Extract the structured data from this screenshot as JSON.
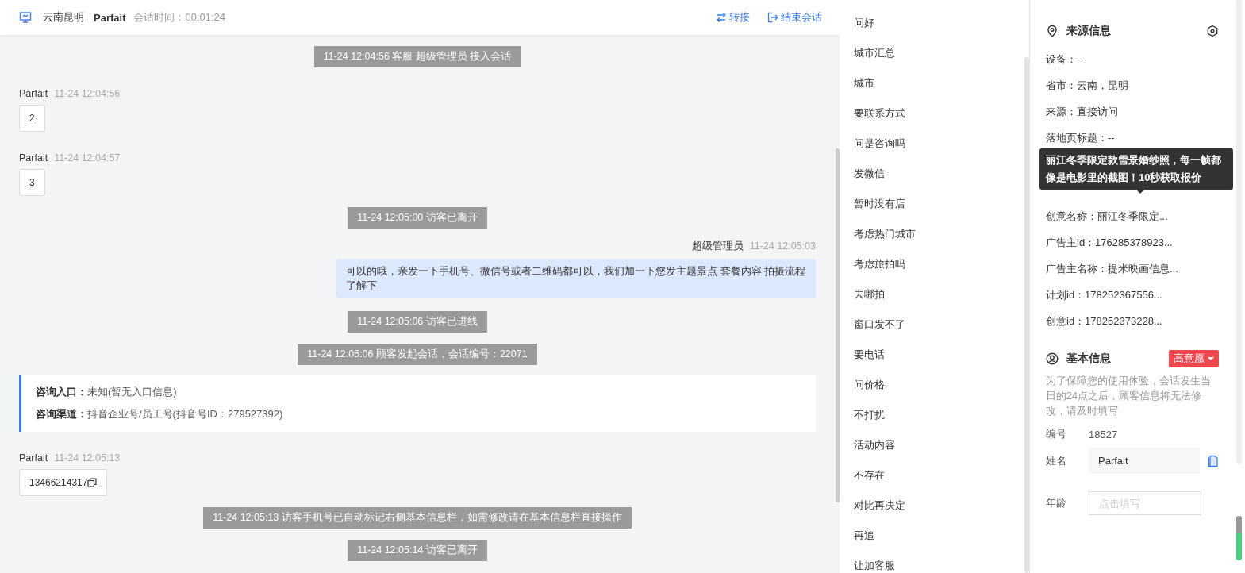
{
  "header": {
    "location": "云南昆明",
    "visitor": "Parfait",
    "timer_label": "会话时间：",
    "timer": "00:01:24",
    "actions": [
      {
        "label": "转接",
        "kind": "transfer"
      },
      {
        "label": "结束会话",
        "kind": "end"
      }
    ]
  },
  "messages": [
    {
      "kind": "system",
      "text": "11-24 12:04:56 客服 超级管理员 接入会话"
    },
    {
      "kind": "visitor",
      "name": "Parfait",
      "time": "11-24 12:04:56",
      "text": "2"
    },
    {
      "kind": "visitor",
      "name": "Parfait",
      "time": "11-24 12:04:57",
      "text": "3"
    },
    {
      "kind": "system",
      "text": "11-24 12:05:00 访客已离开"
    },
    {
      "kind": "agent",
      "name": "超级管理员",
      "time": "11-24 12:05:03",
      "text": "可以的哦，亲发一下手机号、微信号或者二维码都可以，我们加一下您发主题景点 套餐内容 拍摄流程了解下"
    },
    {
      "kind": "system",
      "text": "11-24 12:05:06 访客已进线"
    },
    {
      "kind": "system",
      "text": "11-24 12:05:06 顾客发起会话，会话编号：22071"
    },
    {
      "kind": "info",
      "lines": [
        {
          "label": "咨询入口：",
          "value": "未知(暂无入口信息)"
        },
        {
          "label": "咨询渠道：",
          "value": "抖音企业号/员工号(抖音号ID：279527392)"
        }
      ]
    },
    {
      "kind": "visitor",
      "name": "Parfait",
      "time": "11-24 12:05:13",
      "text": "13466214317",
      "copy": true
    },
    {
      "kind": "system",
      "text": "11-24 12:05:13 访客手机号已自动标记右侧基本信息栏，如需修改请在基本信息栏直接操作"
    },
    {
      "kind": "system",
      "text": "11-24 12:05:14 访客已离开"
    }
  ],
  "quick_replies": [
    "问好",
    "城市汇总",
    "城市",
    "要联系方式",
    "问是咨询吗",
    "发微信",
    "暂时没有店",
    "考虑热门城市",
    "考虑旅拍吗",
    "去哪拍",
    "窗口发不了",
    "要电话",
    "问价格",
    "不打扰",
    "活动内容",
    "不存在",
    "对比再决定",
    "再追",
    "让加客服"
  ],
  "source_info": {
    "title": "来源信息",
    "rows_before": [
      "设备：--",
      "省市：云南，昆明",
      "来源：直接访问",
      "落地页标题：--"
    ],
    "rows_after": [
      "创意名称：丽江冬季限定...",
      "广告主id：176285378923...",
      "广告主名称：提米映画信息...",
      "计划id：178252367556...",
      "创意id：178252373228..."
    ],
    "tooltip": "丽江冬季限定款雪景婚纱照，每一帧都像是电影里的截图！10秒获取报价"
  },
  "basic_info": {
    "title": "基本信息",
    "intent": "高意愿",
    "notice": "为了保障您的使用体验，会话发生当日的24点之后，顾客信息将无法修改，请及时填写",
    "fields": [
      {
        "kind": "static",
        "label": "编号",
        "value": "18527"
      },
      {
        "kind": "filled",
        "label": "姓名",
        "value": "Parfait"
      },
      {
        "kind": "input",
        "label": "年龄",
        "placeholder": "点击填写"
      }
    ]
  }
}
